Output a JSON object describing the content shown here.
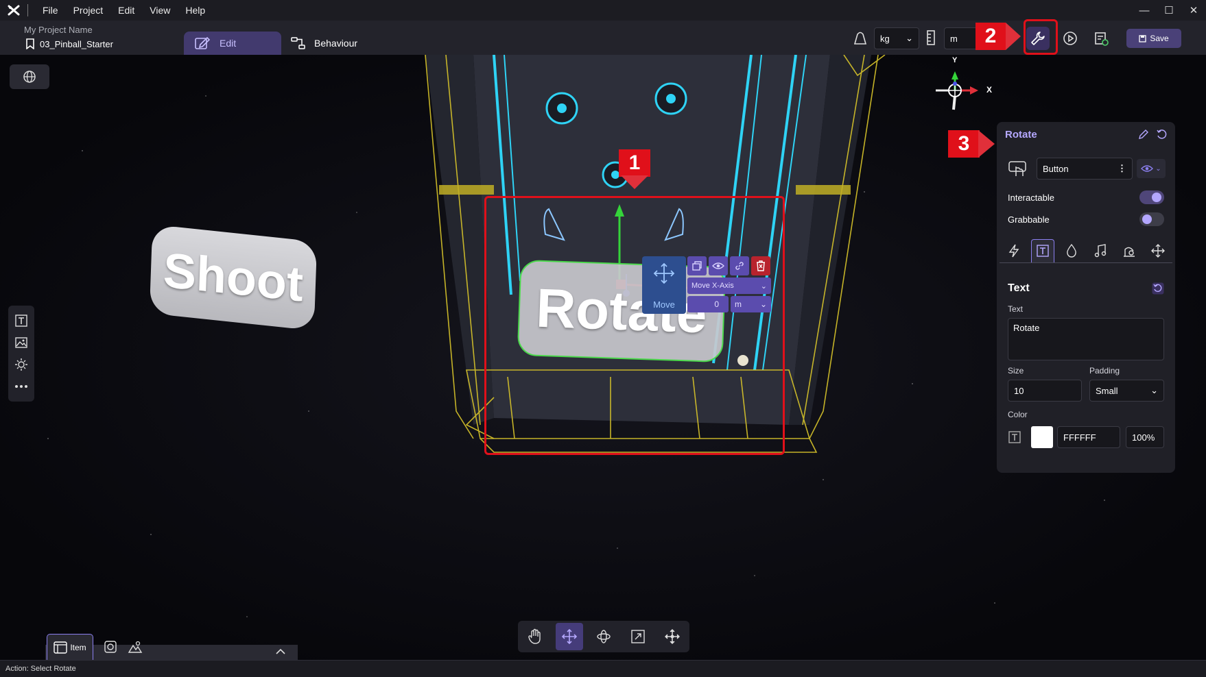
{
  "menu": {
    "items": [
      "File",
      "Project",
      "Edit",
      "View",
      "Help"
    ]
  },
  "header": {
    "project_name": "My Project Name",
    "scene_name": "03_Pinball_Starter",
    "tab_edit": "Edit",
    "tab_behaviour": "Behaviour",
    "mass_unit": "kg",
    "length_unit": "m",
    "save_label": "Save"
  },
  "viewport": {
    "shoot_label": "Shoot",
    "rotate_label": "Rotate",
    "axis_y": "Y",
    "axis_x": "X",
    "gizmo": {
      "mode_label": "Move",
      "axis_option": "Move X-Axis",
      "value": "0",
      "unit": "m"
    }
  },
  "callouts": [
    "1",
    "2",
    "3"
  ],
  "properties": {
    "title": "Rotate",
    "type": "Button",
    "interactable_label": "Interactable",
    "interactable_on": true,
    "grabbable_label": "Grabbable",
    "grabbable_on": false,
    "section_title": "Text",
    "text_label": "Text",
    "text_value": "Rotate",
    "size_label": "Size",
    "size_value": "10",
    "padding_label": "Padding",
    "padding_value": "Small",
    "color_label": "Color",
    "color_hex": "FFFFFF",
    "color_opacity": "100%",
    "swatch_color": "#FFFFFF"
  },
  "bottom": {
    "item_tab": "Item"
  },
  "status": {
    "text": "Action: Select Rotate"
  },
  "colors": {
    "accent": "#8B7FF0",
    "callout": "#E0101A",
    "panel": "#202027"
  }
}
